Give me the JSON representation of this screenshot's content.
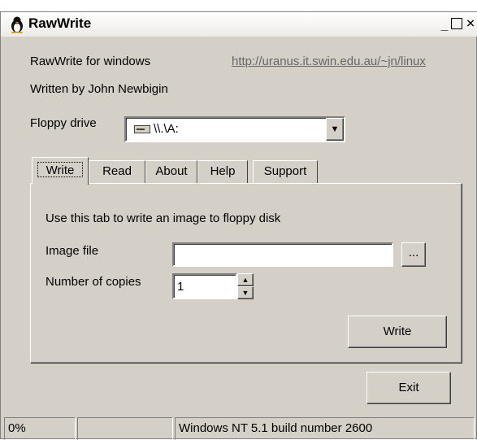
{
  "window": {
    "title": "RawWrite",
    "minimize": "_",
    "maximize": "□",
    "close": "×"
  },
  "header": {
    "app_label": "RawWrite for windows",
    "url": "http://uranus.it.swin.edu.au/~jn/linux",
    "author": "Written by John Newbigin"
  },
  "floppy": {
    "label": "Floppy drive",
    "value": "\\\\.\\A:",
    "icon": "floppy-drive-icon"
  },
  "tabs": [
    {
      "label": "Write",
      "active": true
    },
    {
      "label": "Read",
      "active": false
    },
    {
      "label": "About",
      "active": false
    },
    {
      "label": "Help",
      "active": false
    },
    {
      "label": "Support",
      "active": false
    }
  ],
  "write_tab": {
    "description": "Use this tab to write an image to floppy disk",
    "image_file_label": "Image file",
    "image_file_value": "",
    "browse_label": "...",
    "copies_label": "Number of copies",
    "copies_value": "1",
    "write_button": "Write"
  },
  "exit_button": "Exit",
  "status": {
    "progress": "0%",
    "middle": "",
    "os": "Windows NT 5.1 build number 2600"
  }
}
